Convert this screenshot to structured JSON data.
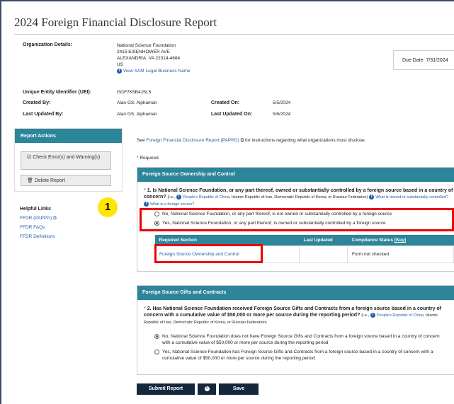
{
  "page": {
    "title": "2024 Foreign Financial Disclosure Report"
  },
  "org": {
    "label": "Organization Details:",
    "name": "National Science Foundation",
    "street": "2415 EISENHOWER AVE",
    "city": "ALEXANDRIA, VA 22314-4684",
    "country": "US",
    "sam_link": "View SAM Legal Business Name",
    "due_date": "Due Date: 7/31/2024"
  },
  "meta": {
    "uei_label": "Unique Entity Identifier (UEI):",
    "uei_value": "GGF7K5B4JSL5",
    "created_by_label": "Created By:",
    "created_by_value": "Alan GS. Alphaman",
    "created_on_label": "Created On:",
    "created_on_value": "5/5/2024",
    "updated_by_label": "Last Updated By:",
    "updated_by_value": "Alan GS. Alphaman",
    "updated_on_label": "Last Updated On:",
    "updated_on_value": "5/6/2024"
  },
  "sidebar": {
    "actions_title": "Report Actions",
    "check_label": "Check Error(s) and Warning(s)",
    "delete_label": "Delete Report",
    "helpful_title": "Helpful Links",
    "links": [
      "FFDR (PAPPG)",
      "FFDR FAQs",
      "FFDR Definitions"
    ]
  },
  "intro": {
    "see": "See",
    "link": "Foreign Financial Disclosure Report (PAPPG)",
    "rest": "for instructions regarding what organizations must disclose.",
    "required_star": "*",
    "required": "Required"
  },
  "section1": {
    "title": "Foreign Source Ownership and Control",
    "q_star": "*",
    "q_bold": "1. Is National Science Foundation, or any part thereof, owned or substantially controlled by a foreign source based in a country of concern?",
    "q_eg": "(i.e.,",
    "q_prc": "People's Republic of China",
    "q_rest": ", Islamic Republic of Iran, Democratic Republic of Korea, or Russian Federation)",
    "link_owned": "What is owned or substantially controlled?",
    "link_foreign": "What is a foreign source?",
    "opt_no": "No, National Science Foundation, or any part thereof, is not owned or substantially controlled by a foreign source",
    "opt_yes": "Yes, National Science Foundation, or any part thereof, is owned or substantially controlled by a foreign source",
    "table_headers": [
      "Required Section",
      "Last Updated",
      "Compliance Status"
    ],
    "table_key": "[Key]",
    "row_section": "Foreign Source Ownership and Control",
    "row_updated": "",
    "row_status": "Form not checked"
  },
  "section2": {
    "title": "Foreign Source Gifts and Contracts",
    "q_star": "*",
    "q_bold": "2. Has National Science Foundation received Foreign Source Gifts and Contracts from a foreign source based in a country of concern with a cumulative value of $50,000 or more per source during the reporting period?",
    "q_eg": "(i.e.,",
    "q_prc": "People's Republic of China",
    "q_rest": ", Islamic Republic of Iran, Democratic Republic of Korea, or Russian Federation)",
    "opt_no": "No, National Science Foundation does not have Foreign Source Gifts and Contracts from a foreign source based in a country of concern with a cumulative value of $50,000 or more per source during the reporting period",
    "opt_yes": "Yes, National Science Foundation has Foreign Source Gifts and Contracts from a foreign source based in a country of concern with a cumulative value of $50,000 or more per source during the reporting period"
  },
  "footer": {
    "submit": "Submit Report",
    "info": "i",
    "save": "Save"
  },
  "callout": "1",
  "colors": {
    "teal": "#2d8599",
    "navy": "#14273d",
    "red": "#e00000",
    "yellow": "#ffe600",
    "link": "#1f5fa8"
  },
  "icons": [
    "info-icon",
    "external-link-icon",
    "check-icon",
    "trash-icon"
  ]
}
